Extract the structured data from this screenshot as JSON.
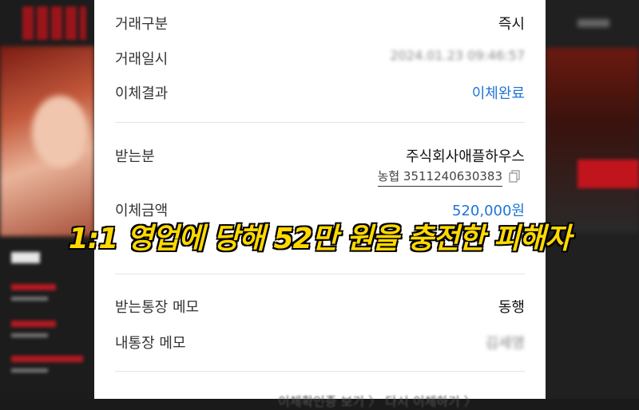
{
  "transfer": {
    "type_label": "거래구분",
    "type_value": "즉시",
    "date_label": "거래일시",
    "date_value": "2024.01.23 09:46:57",
    "result_label": "이체결과",
    "result_value": "이체완료",
    "recipient_label": "받는분",
    "recipient_name": "주식회사애플하우스",
    "recipient_account": "농협 3511240630383",
    "amount_label": "이체금액",
    "amount_value": "520,000원",
    "recipient_memo_label": "받는통장 메모",
    "recipient_memo_value": "동행",
    "my_memo_label": "내통장 메모",
    "my_memo_value": "김세영"
  },
  "caption": "1:1 영업에 당해 52만 원을 충전한 피해자",
  "footer_partial": "이체확인증 보기  〉   다시 이체하기  〉",
  "colors": {
    "accent_blue": "#1f73d9",
    "caption_yellow": "#ffd900",
    "brand_red": "#b0141b"
  },
  "icons": {
    "copy": "copy-icon"
  }
}
